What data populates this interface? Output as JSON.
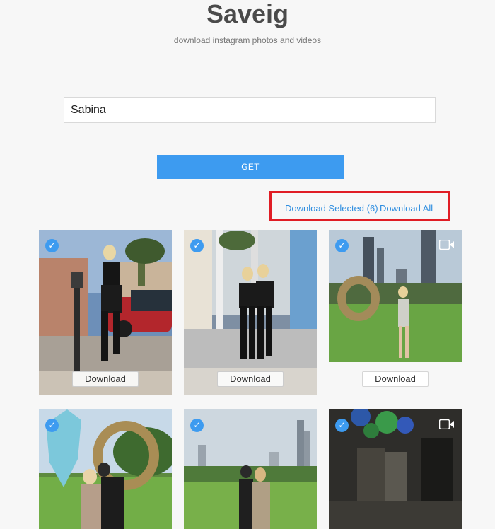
{
  "header": {
    "title": "Saveig",
    "subtitle": "download instagram photos and videos"
  },
  "search": {
    "value": "Sabina",
    "button_label": "GET"
  },
  "bulk_actions": {
    "download_selected": "Download Selected (6)",
    "download_all": "Download All",
    "highlight_color": "#e01d25"
  },
  "media": [
    {
      "type": "photo",
      "selected": true,
      "download_label": "Download",
      "icon": "check-icon"
    },
    {
      "type": "photo",
      "selected": true,
      "download_label": "Download",
      "icon": "check-icon"
    },
    {
      "type": "video",
      "selected": true,
      "download_label": "Download",
      "icon": "video-camera-icon"
    },
    {
      "type": "photo",
      "selected": true,
      "icon": "check-icon"
    },
    {
      "type": "photo",
      "selected": true,
      "icon": "check-icon"
    },
    {
      "type": "video",
      "selected": true,
      "icon": "video-camera-icon"
    }
  ],
  "colors": {
    "accent": "#3d9bf0",
    "link": "#2f8ee0",
    "background": "#f7f7f7"
  }
}
